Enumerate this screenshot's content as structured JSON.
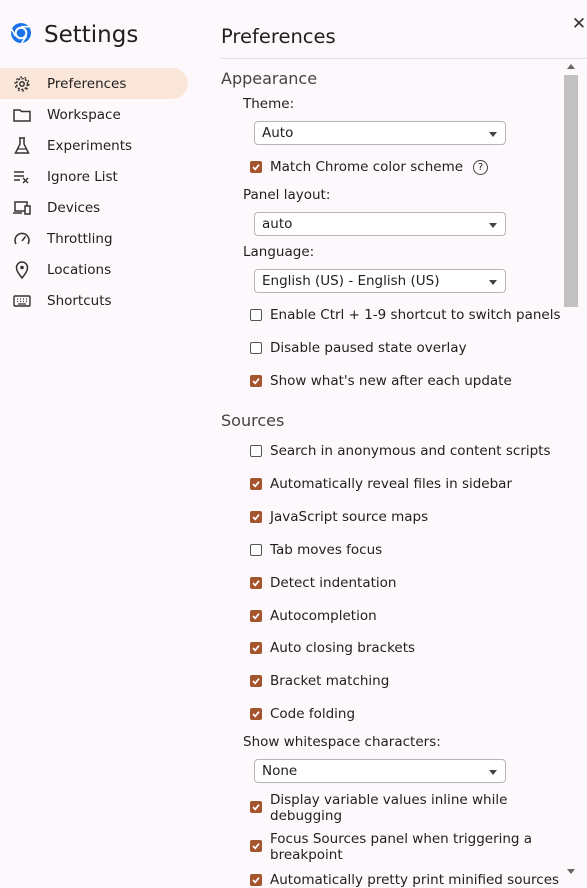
{
  "sidebar": {
    "title": "Settings",
    "items": [
      {
        "label": "Preferences",
        "icon": "gear-icon",
        "active": true
      },
      {
        "label": "Workspace",
        "icon": "folder-icon"
      },
      {
        "label": "Experiments",
        "icon": "flask-icon"
      },
      {
        "label": "Ignore List",
        "icon": "ignore-list-icon"
      },
      {
        "label": "Devices",
        "icon": "devices-icon"
      },
      {
        "label": "Throttling",
        "icon": "speedometer-icon"
      },
      {
        "label": "Locations",
        "icon": "location-pin-icon"
      },
      {
        "label": "Shortcuts",
        "icon": "keyboard-icon"
      }
    ]
  },
  "header": {
    "title": "Preferences",
    "close_icon": "close-icon"
  },
  "appearance": {
    "section_title": "Appearance",
    "theme_label": "Theme:",
    "theme_value": "Auto",
    "match_chrome": "Match Chrome color scheme",
    "panel_layout_label": "Panel layout:",
    "panel_layout_value": "auto",
    "language_label": "Language:",
    "language_value": "English (US) - English (US)",
    "ctrl_shortcut": "Enable Ctrl + 1-9 shortcut to switch panels",
    "disable_paused_overlay": "Disable paused state overlay",
    "show_whats_new": "Show what's new after each update"
  },
  "sources": {
    "section_title": "Sources",
    "search_anonymous": "Search in anonymous and content scripts",
    "reveal_files": "Automatically reveal files in sidebar",
    "js_source_maps": "JavaScript source maps",
    "tab_moves_focus": "Tab moves focus",
    "detect_indentation": "Detect indentation",
    "autocompletion": "Autocompletion",
    "auto_closing": "Auto closing brackets",
    "bracket_matching": "Bracket matching",
    "code_folding": "Code folding",
    "whitespace_label": "Show whitespace characters:",
    "whitespace_value": "None",
    "display_inline_1": "Display variable values inline while",
    "display_inline_2": "debugging",
    "focus_sources_1": "Focus Sources panel when triggering a",
    "focus_sources_2": "breakpoint",
    "pretty_print": "Automatically pretty print minified sources"
  },
  "colors": {
    "accent": "#a5552e",
    "active_nav_bg": "#fbe7da",
    "background": "#fdf8fb"
  }
}
